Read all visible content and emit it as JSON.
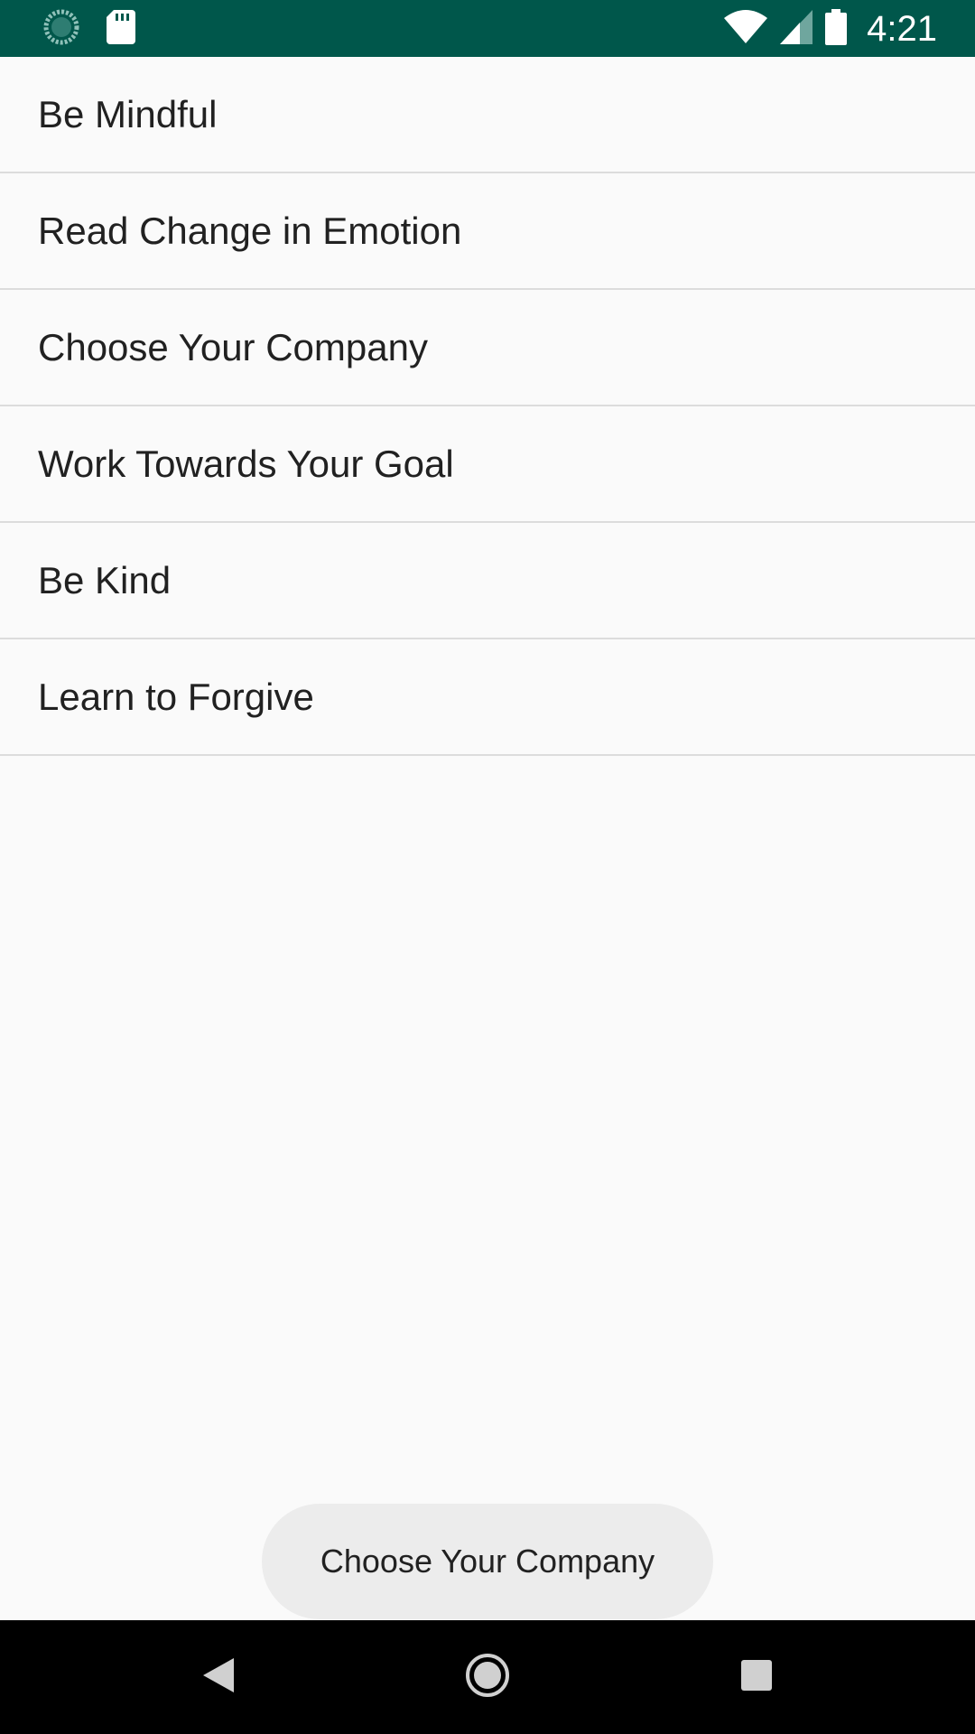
{
  "status_bar": {
    "time": "4:21",
    "background": "#00574b",
    "icons": [
      "sync-icon",
      "sd-card-icon",
      "wifi-icon",
      "signal-icon",
      "battery-icon"
    ]
  },
  "list": {
    "items": [
      {
        "label": "Be Mindful"
      },
      {
        "label": "Read Change in Emotion"
      },
      {
        "label": "Choose Your Company"
      },
      {
        "label": "Work Towards Your Goal"
      },
      {
        "label": "Be Kind"
      },
      {
        "label": "Learn to Forgive"
      }
    ]
  },
  "toast": {
    "message": "Choose Your Company"
  },
  "nav_bar": {
    "icons": [
      "back-icon",
      "home-icon",
      "recents-icon"
    ]
  }
}
